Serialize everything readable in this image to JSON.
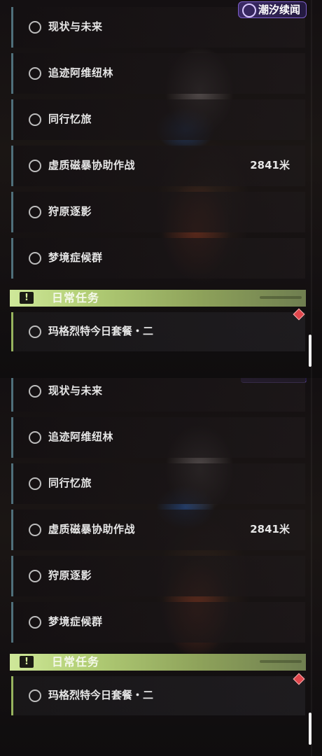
{
  "logo": {
    "text": "潮汐续闻"
  },
  "quests": [
    {
      "name": "现状与未来",
      "distance": ""
    },
    {
      "name": "追迹阿维纽林",
      "distance": ""
    },
    {
      "name": "同行忆旅",
      "distance": ""
    },
    {
      "name": "虚质磁暴协助作战",
      "distance": "2841米"
    },
    {
      "name": "狩原逐影",
      "distance": ""
    },
    {
      "name": "梦境症候群",
      "distance": ""
    }
  ],
  "daily": {
    "header": "日常任务",
    "icon": "!",
    "item": "玛格烈特今日套餐・二"
  }
}
